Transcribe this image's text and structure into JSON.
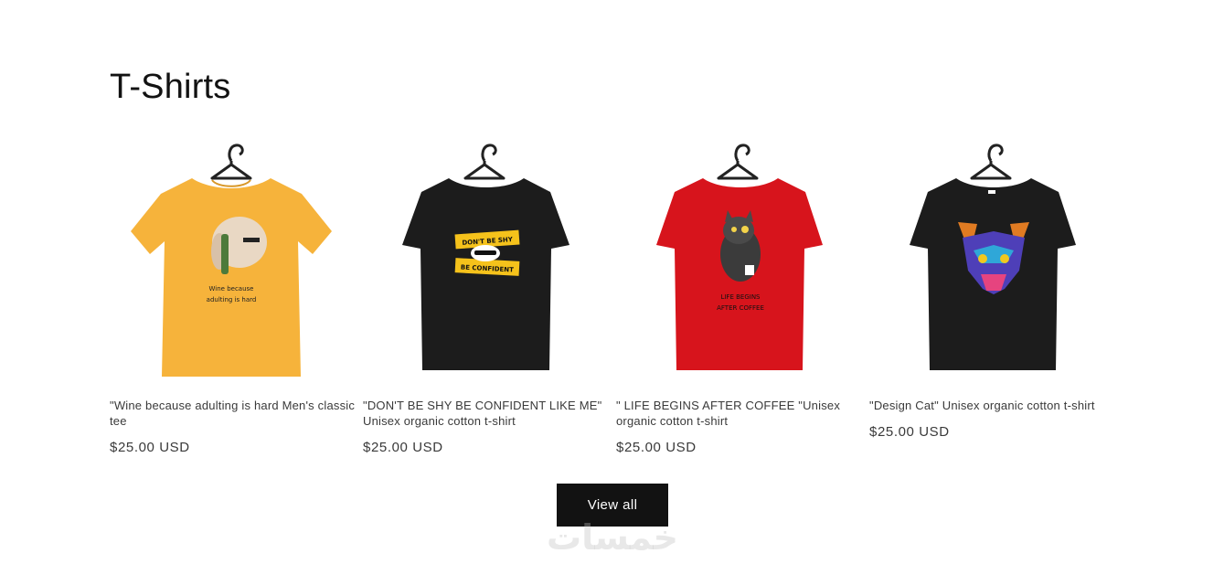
{
  "section": {
    "title": "T-Shirts"
  },
  "products": [
    {
      "title": "\"Wine because adulting is hard Men's classic tee",
      "price": "$25.00 USD",
      "shirt_color": "#f6b33b",
      "print_text": [
        "Wine because",
        "adulting is hard"
      ]
    },
    {
      "title": "\"DON'T BE SHY BE CONFIDENT LIKE ME\" Unisex organic cotton t-shirt",
      "price": "$25.00 USD",
      "shirt_color": "#1c1c1c",
      "print_text": [
        "DON'T BE SHY",
        "BE CONFIDENT"
      ]
    },
    {
      "title": "\" LIFE BEGINS AFTER COFFEE \"Unisex organic cotton t-shirt",
      "price": "$25.00 USD",
      "shirt_color": "#d7141c",
      "print_text": [
        "LIFE BEGINS",
        "AFTER COFFEE"
      ]
    },
    {
      "title": "\"Design Cat\" Unisex organic cotton t-shirt",
      "price": "$25.00 USD",
      "shirt_color": "#1c1c1c",
      "print_text": []
    }
  ],
  "actions": {
    "view_all": "View all"
  },
  "watermark": {
    "text": "خمسات"
  }
}
